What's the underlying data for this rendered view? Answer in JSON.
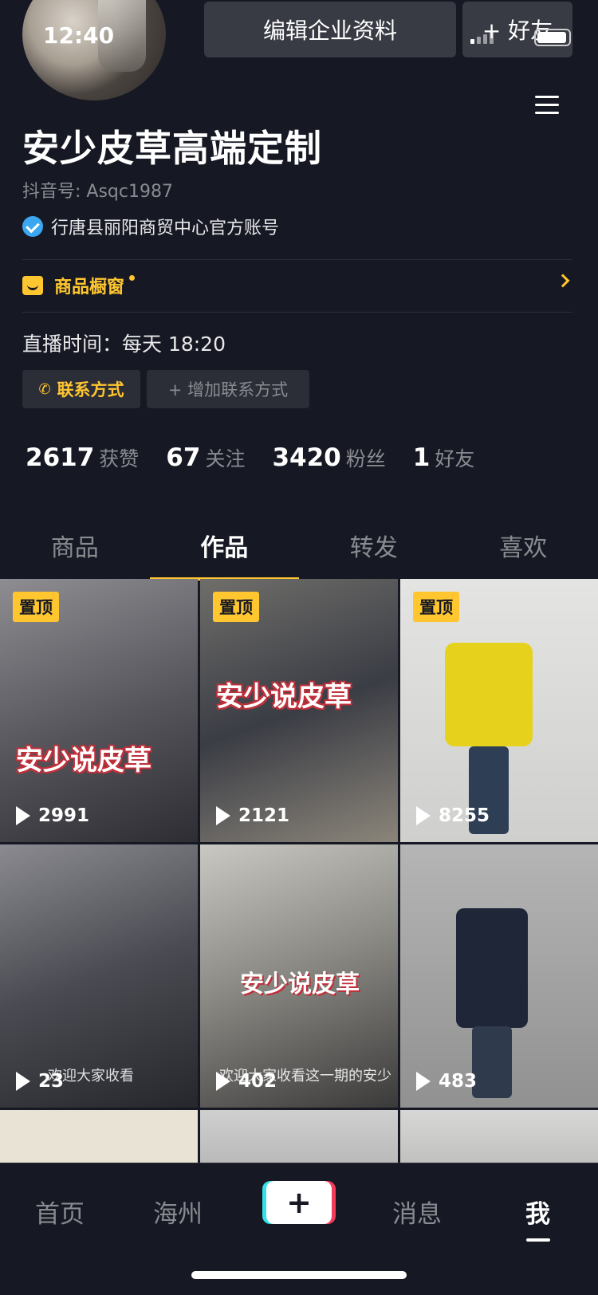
{
  "status_bar": {
    "time": "12:40"
  },
  "header": {
    "edit_button": "编辑企业资料",
    "add_friend_button": "+ 好友"
  },
  "profile": {
    "name": "安少皮草高端定制",
    "douyin_id": "抖音号: Asqc1987",
    "verified_label": "行唐县丽阳商贸中心官方账号",
    "shop_label": "商品橱窗",
    "live_time": "直播时间：每天 18:20",
    "contact_button": "联系方式",
    "add_contact_button": "+ 增加联系方式"
  },
  "stats": [
    {
      "num": "2617",
      "label": "获赞"
    },
    {
      "num": "67",
      "label": "关注"
    },
    {
      "num": "3420",
      "label": "粉丝"
    },
    {
      "num": "1",
      "label": "好友"
    }
  ],
  "tabs": [
    "商品",
    "作品",
    "转发",
    "喜欢"
  ],
  "videos": [
    {
      "pinned": "置顶",
      "caption": "安少说皮草",
      "views": "2991",
      "bg": "#6b6a6f"
    },
    {
      "pinned": "置顶",
      "caption": "安少说皮草",
      "views": "2121",
      "bg": "#4b4d55"
    },
    {
      "pinned": "置顶",
      "caption": "",
      "views": "8255",
      "bg": "#cfcfcd"
    },
    {
      "pinned": "",
      "caption": "",
      "subcaption": "欢迎大家收看",
      "views": "23",
      "bg": "#55565c"
    },
    {
      "pinned": "",
      "caption": "安少说皮草",
      "subcaption": "欢迎大家收看这一期的安少",
      "views": "402",
      "bg": "#8d8c86"
    },
    {
      "pinned": "",
      "caption": "",
      "views": "483",
      "bg": "#9a9b9a"
    }
  ],
  "bottom_nav": {
    "home": "首页",
    "city": "海州",
    "plus": "+",
    "messages": "消息",
    "me": "我"
  },
  "colors": {
    "accent": "#ffc630",
    "background": "#161823",
    "verify_blue": "#3ba7f0"
  }
}
